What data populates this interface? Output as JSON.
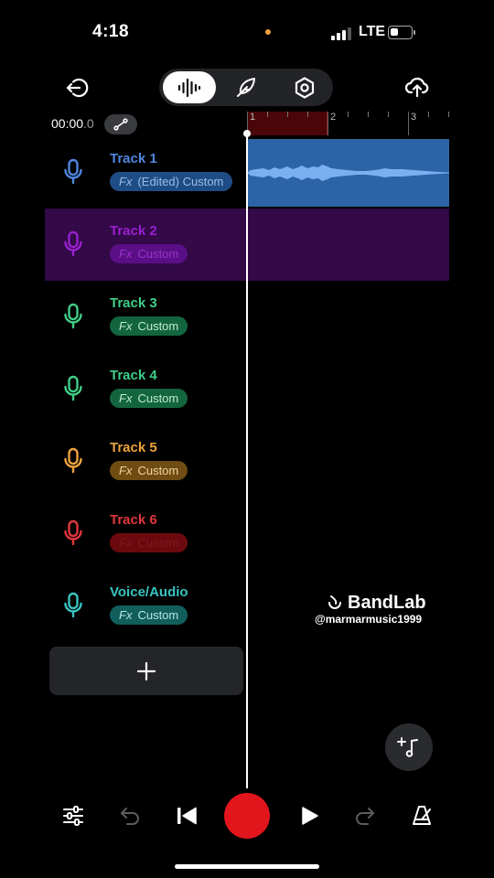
{
  "status_bar": {
    "time": "4:18",
    "network": "LTE"
  },
  "toolbar": {
    "exit_icon": "exit-icon",
    "modes": [
      "waveform-icon",
      "quill-icon",
      "hexagon-settings-icon"
    ],
    "active_mode": "waveform-icon",
    "upload_icon": "cloud-upload-icon"
  },
  "timeline": {
    "position": "00:00",
    "position_fraction": ".0",
    "ruler_numbers": [
      "1",
      "2",
      "3"
    ]
  },
  "tracks": [
    {
      "name": "Track 1",
      "fx_prefix": "Fx",
      "fx_label": "(Edited) Custom",
      "color": "#4f86e0",
      "pill_bg": "#1e4d86",
      "pill_text": "#9dbde6",
      "selected": false
    },
    {
      "name": "Track 2",
      "fx_prefix": "Fx",
      "fx_label": "Custom",
      "color": "#9a1fd0",
      "pill_bg": "#5a0f86",
      "pill_text": "#9a33c9",
      "selected": true
    },
    {
      "name": "Track 3",
      "fx_prefix": "Fx",
      "fx_label": "Custom",
      "color": "#3fcf86",
      "pill_bg": "#13653f",
      "pill_text": "#bfe9d0",
      "selected": false
    },
    {
      "name": "Track 4",
      "fx_prefix": "Fx",
      "fx_label": "Custom",
      "color": "#3fcf86",
      "pill_bg": "#13653f",
      "pill_text": "#bfe9d0",
      "selected": false
    },
    {
      "name": "Track 5",
      "fx_prefix": "Fx",
      "fx_label": "Custom",
      "color": "#eca33e",
      "pill_bg": "#6e4c12",
      "pill_text": "#f2d3a0",
      "selected": false
    },
    {
      "name": "Track 6",
      "fx_prefix": "Fx",
      "fx_label": "Custom",
      "color": "#e0363d",
      "pill_bg": "#6b0a0e",
      "pill_text": "#7a1a1e",
      "selected": false
    },
    {
      "name": "Voice/Audio",
      "fx_prefix": "Fx",
      "fx_label": "Custom",
      "color": "#36c4c0",
      "pill_bg": "#115e5c",
      "pill_text": "#b5e6e4",
      "selected": false
    }
  ],
  "add_track_icon": "plus-icon",
  "watermark": {
    "brand": "BandLab",
    "user": "@marmarmusic1999"
  },
  "fab_icon": "add-music-note-icon",
  "bottom_bar": {
    "icons": [
      "mixer-sliders-icon",
      "undo-icon",
      "skip-back-icon",
      "record-button",
      "play-icon",
      "redo-icon",
      "metronome-icon"
    ]
  }
}
